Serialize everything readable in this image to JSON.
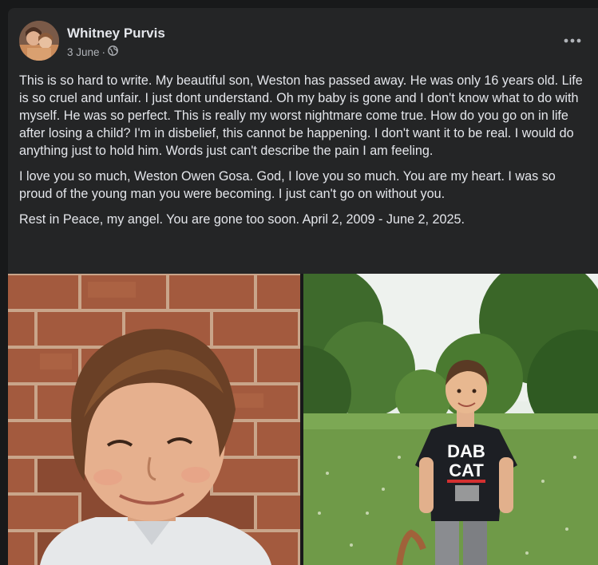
{
  "post": {
    "author": "Whitney Purvis",
    "date": "3 June",
    "separator": "·",
    "audience_icon": "globe-icon",
    "more_icon": "more-horizontal-icon",
    "paragraphs": [
      "This is so hard to write. My beautiful son, Weston has passed away.  He was only 16 years old. Life is so cruel and unfair. I just dont understand. Oh my baby is gone and I don't know what to do with myself. He was so perfect. This is really my worst nightmare come true. How do you go on in life after losing a child?  I'm in disbelief, this cannot be happening. I don't want it to be real.  I would do anything just to hold him. Words just can't describe the pain I am feeling.",
      "I love you so much, Weston Owen Gosa.  God, I love you so much.  You are my heart.  I was so proud of the young man you were becoming. I just can't go on without you.",
      "Rest in Peace, my angel.  You are gone too soon.  April 2, 2009 - June 2, 2025."
    ],
    "photos": {
      "left": {
        "shirt_text": ""
      },
      "right": {
        "shirt_text_line1": "DAB",
        "shirt_text_line2": "CAT"
      }
    }
  },
  "colors": {
    "page_bg": "#18191a",
    "card_bg": "#242526",
    "primary_text": "#e4e6eb",
    "secondary_text": "#b0b3b8"
  }
}
